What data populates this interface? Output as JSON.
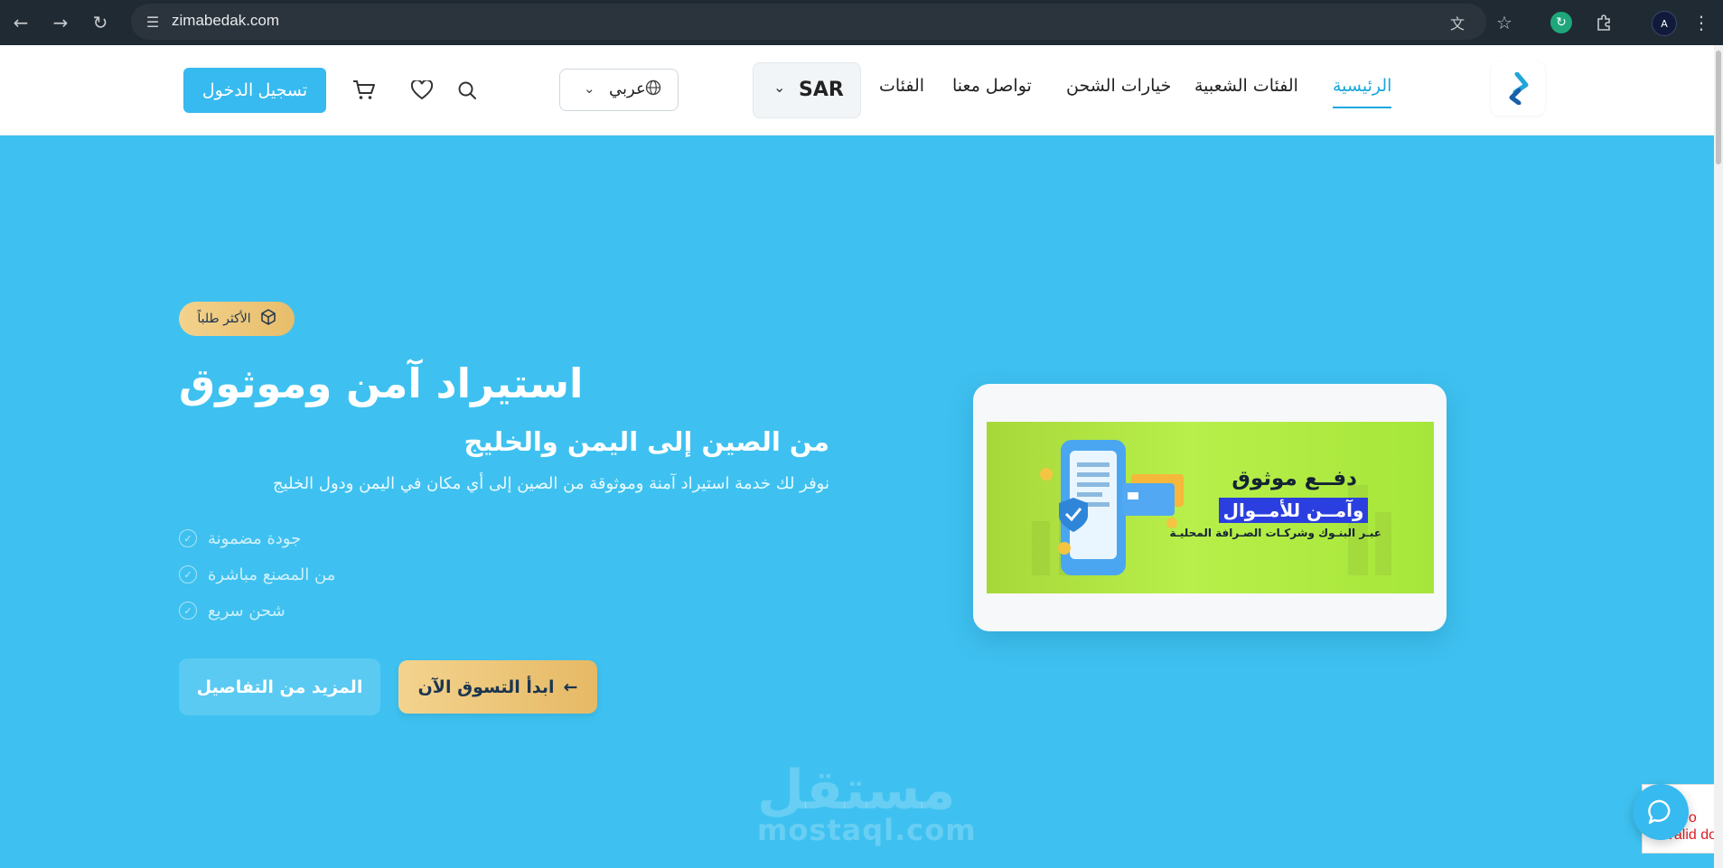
{
  "browser": {
    "url": "zimabedak.com",
    "profile_initial": "A",
    "icons": [
      "back-icon",
      "forward-icon",
      "reload-icon",
      "site-settings-icon",
      "translate-icon",
      "star-icon",
      "extension-icon",
      "puzzle-icon",
      "menu-icon"
    ]
  },
  "header": {
    "nav": {
      "home": "الرئيسية",
      "popular": "الفئات الشعبية",
      "shipping": "خيارات الشحن",
      "contact": "تواصل معنا",
      "categories": "الفئات"
    },
    "currency": "SAR",
    "language": "عربي",
    "login": "تسجيل الدخول",
    "accent_color": "#1aa7dc",
    "button_color": "#36baf0"
  },
  "hero": {
    "badge": "الأكثر طلباً",
    "title": "استيراد آمن وموثوق",
    "subtitle": "من الصين إلى اليمن والخليج",
    "description": "نوفر لك خدمة استيراد آمنة وموثوقة من الصين إلى أي مكان في اليمن ودول الخليج",
    "features": [
      "جودة مضمونة",
      "من المصنع مباشرة",
      "شحن سريع"
    ],
    "cta_primary": "ابدأ التسوق الآن",
    "cta_secondary": "المزيد من التفاصيل",
    "background_color": "#3ec1f0"
  },
  "banner": {
    "line1": "دفــع موثوق",
    "line2": "وآمــن للأمــوال",
    "line3": "عبـر البنـوك وشركـات الصـرافة المحليـة"
  },
  "watermark": {
    "arabic": "مستقل",
    "latin": "mostaql.com"
  },
  "error_box": {
    "line1": "OR fo",
    "line2": "nvalid do"
  }
}
